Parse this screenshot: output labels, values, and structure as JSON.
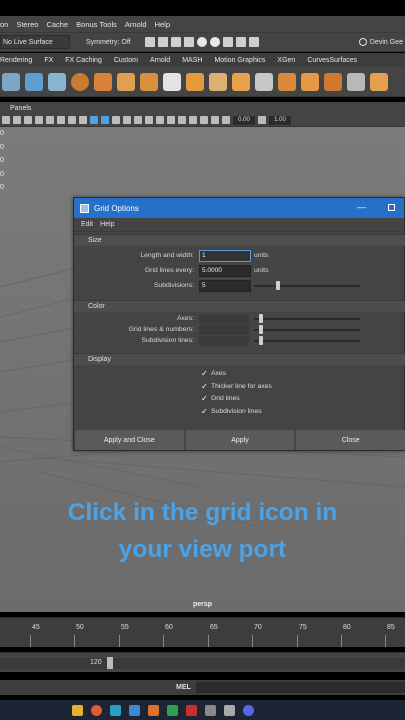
{
  "menubar": {
    "items": [
      "on",
      "Stereo",
      "Cache",
      "Bonus Tools",
      "Arnold",
      "Help"
    ]
  },
  "statusline": {
    "live_surface": "No Live Surface",
    "symmetry": "Symmetry: Off",
    "user": "Devin Gee"
  },
  "shelf_tabs": [
    "Rendering",
    "FX",
    "FX Caching",
    "Custom",
    "Arnold",
    "MASH",
    "Motion Graphics",
    "XGen",
    "CurvesSurfaces"
  ],
  "panel_menu": {
    "panels": "Panels"
  },
  "panel_toolbar": {
    "val1": "0.00",
    "val2": "1.00"
  },
  "viewport": {
    "zeros": [
      "0",
      "0",
      "0",
      "0",
      "0"
    ],
    "camera_label": "persp",
    "caption_line1": "Click in the grid icon in",
    "caption_line2": "your view port"
  },
  "dialog": {
    "title": "Grid Options",
    "minimize": "—",
    "menu": [
      "Edit",
      "Help"
    ],
    "size_section": {
      "header": "Size",
      "length_label": "Length and width:",
      "length_value": "1",
      "length_unit": "units",
      "lines_label": "Grid lines every:",
      "lines_value": "5.0000",
      "lines_unit": "units",
      "subdiv_label": "Subdivisions:",
      "subdiv_value": "5"
    },
    "color_section": {
      "header": "Color",
      "axes_label": "Axes:",
      "grid_label": "Grid lines & numbers:",
      "subdiv_label": "Subdivision lines:"
    },
    "display_section": {
      "header": "Display",
      "checks": [
        "Axes",
        "Thicker line for axes",
        "Grid lines",
        "Subdivision lines"
      ]
    },
    "buttons": {
      "apply_close": "Apply and Close",
      "apply": "Apply",
      "close": "Close"
    }
  },
  "timeline": {
    "ticks": [
      "45",
      "50",
      "55",
      "60",
      "65",
      "70",
      "75",
      "80",
      "85"
    ],
    "range_end": "120",
    "mel_label": "MEL"
  },
  "colors": {
    "accent_blue": "#4aa3e8",
    "title_bar": "#2670c9"
  }
}
